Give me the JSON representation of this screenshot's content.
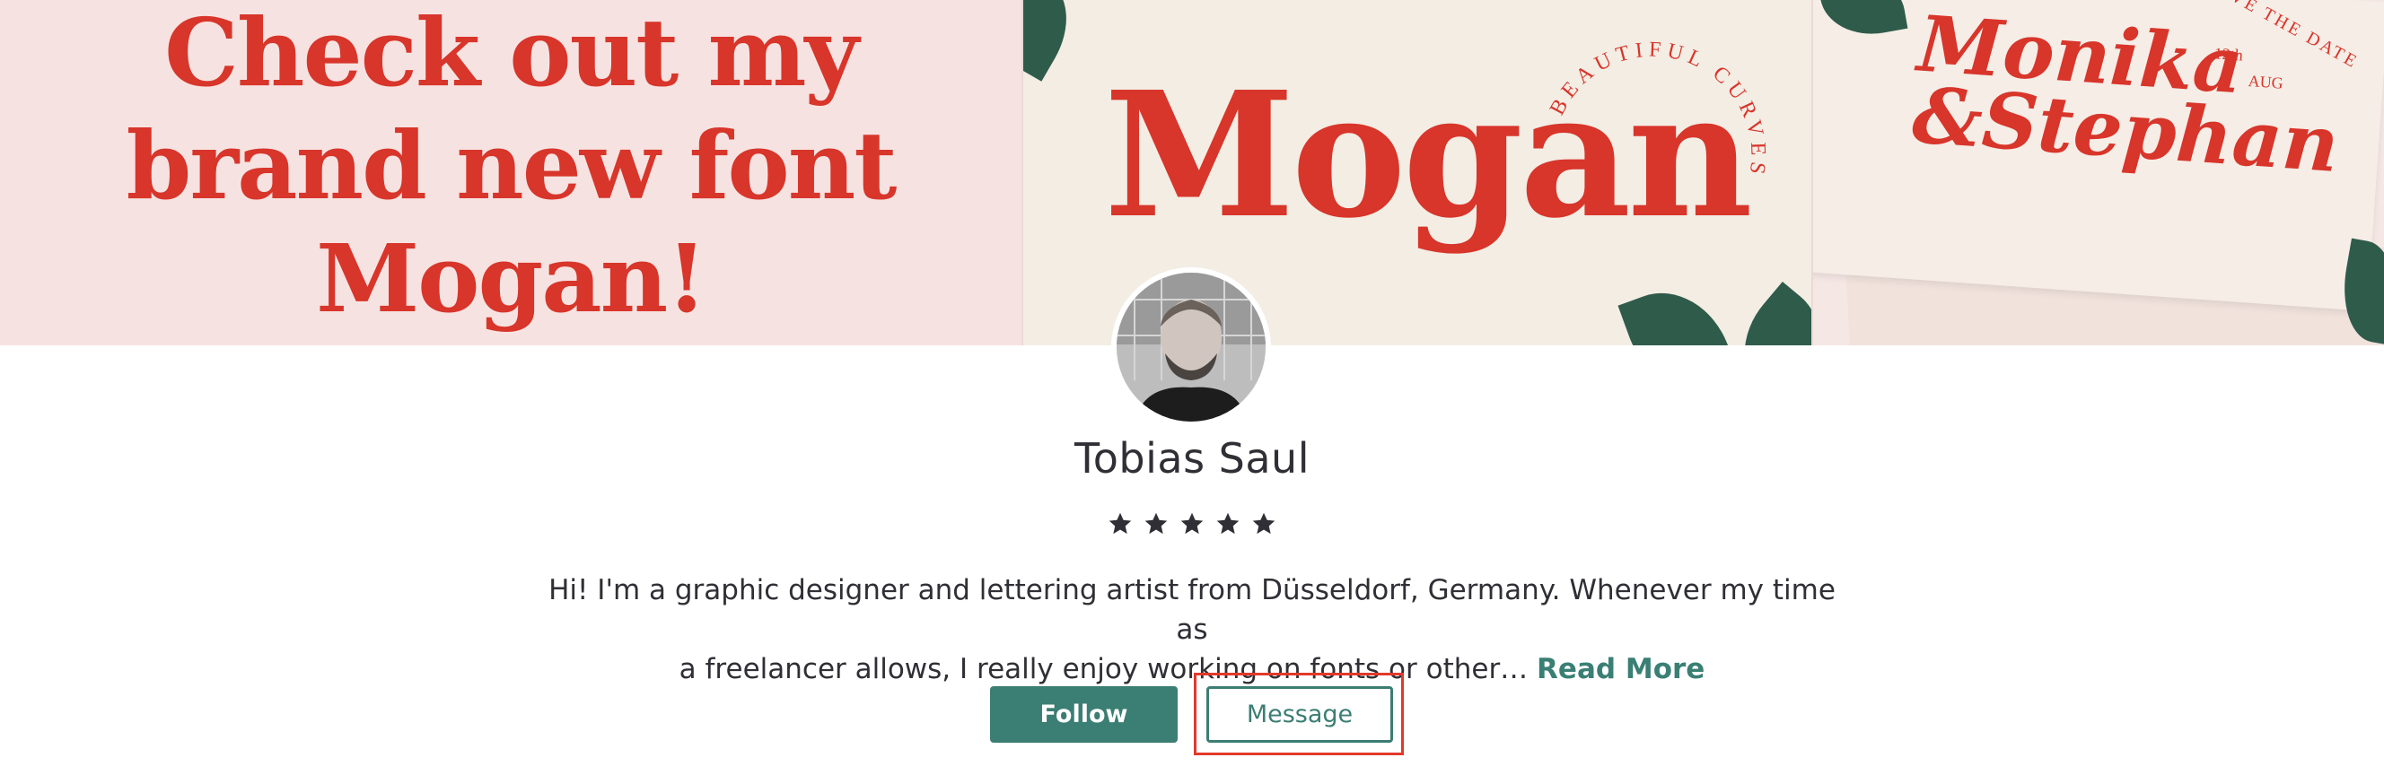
{
  "banner": {
    "promo_lines": [
      "Check out my",
      "brand new font",
      "Mogan!"
    ],
    "mogan_word": "Mogan",
    "curves_text": "BEAUTIFUL CURVES",
    "card_script_1": "Monika",
    "card_script_2": "&Stephan",
    "save_the_date": "SAVE THE DATE",
    "date_day": "12th",
    "date_month": "AUG"
  },
  "profile": {
    "name": "Tobias Saul",
    "rating": 5,
    "bio_line_1": "Hi! I'm a graphic designer and lettering artist from Düsseldorf, Germany. Whenever my time as",
    "bio_line_2": "a freelancer allows, I really enjoy working on fonts or other…",
    "read_more": "Read More"
  },
  "actions": {
    "follow": "Follow",
    "message": "Message"
  },
  "colors": {
    "accent": "#3b7e73",
    "banner_red": "#d8352b",
    "highlight": "#e2392b"
  }
}
